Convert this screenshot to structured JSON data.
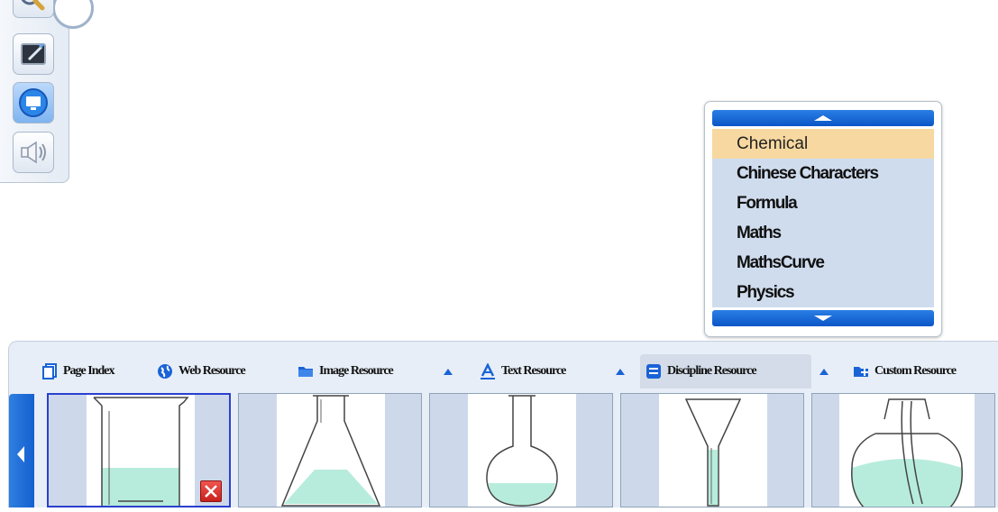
{
  "toolbar": {
    "buttons": [
      {
        "name": "search-tool",
        "icon": "magnifier-icon"
      },
      {
        "name": "blackboard-tool",
        "icon": "blackboard-icon"
      },
      {
        "name": "screen-tool",
        "icon": "monitor-icon"
      },
      {
        "name": "sound-tool",
        "icon": "speaker-icon"
      }
    ]
  },
  "popup": {
    "items": [
      {
        "label": "Chemical",
        "selected": true
      },
      {
        "label": "Chinese Characters",
        "selected": false
      },
      {
        "label": "Formula",
        "selected": false
      },
      {
        "label": "Maths",
        "selected": false
      },
      {
        "label": "MathsCurve",
        "selected": false
      },
      {
        "label": "Physics",
        "selected": false
      }
    ],
    "scroll_up_icon": "triangle-up-icon",
    "scroll_down_icon": "triangle-down-icon"
  },
  "panel": {
    "tabs": [
      {
        "label": "Page Index",
        "icon": "page-index-icon"
      },
      {
        "label": "Web Resource",
        "icon": "globe-icon"
      },
      {
        "label": "Image Resource",
        "icon": "folder-icon"
      },
      {
        "label": "Text Resource",
        "icon": "text-a-icon"
      },
      {
        "label": "Discipline Resource",
        "icon": "discipline-icon",
        "active": true
      },
      {
        "label": "Custom Resource",
        "icon": "folder-plus-icon"
      }
    ],
    "thumbnails": [
      {
        "name": "beaker",
        "selected": true
      },
      {
        "name": "erlenmeyer-flask",
        "selected": false
      },
      {
        "name": "round-bottom-flask",
        "selected": false
      },
      {
        "name": "funnel",
        "selected": false
      },
      {
        "name": "bell-jar",
        "selected": false
      }
    ]
  },
  "colors": {
    "accent_blue": "#1a63d6",
    "selected_item": "#f7d8a0",
    "list_bg": "#cfdcee",
    "liquid": "#b7ecdc",
    "delete_red": "#d9302b"
  }
}
